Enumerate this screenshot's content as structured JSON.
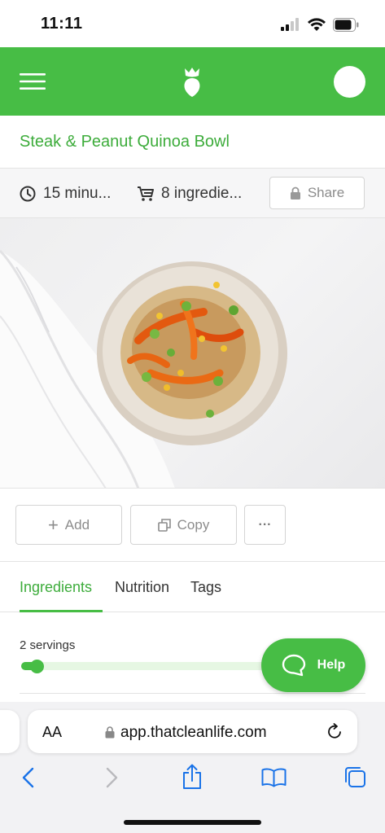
{
  "status_bar": {
    "time": "11:11"
  },
  "app_bar": {
    "menu_icon": "hamburger-menu-icon",
    "logo_icon": "leaf-logo-icon",
    "avatar_icon": "profile-avatar"
  },
  "recipe": {
    "title": "Steak & Peanut Quinoa Bowl",
    "time": "15 minu...",
    "ingredients_count": "8 ingredie...",
    "share_label": "Share"
  },
  "actions": {
    "add_label": "Add",
    "copy_label": "Copy",
    "more_label": "···"
  },
  "tabs": [
    {
      "label": "Ingredients",
      "active": true
    },
    {
      "label": "Nutrition",
      "active": false
    },
    {
      "label": "Tags",
      "active": false
    }
  ],
  "servings": {
    "label": "2 servings",
    "level": 0.06
  },
  "help": {
    "label": "Help"
  },
  "browser": {
    "aa_label": "AA",
    "url": "app.thatcleanlife.com"
  },
  "colors": {
    "brand_green": "#47bd45",
    "title_green": "#3dac3b",
    "ios_blue": "#1a73e8"
  }
}
